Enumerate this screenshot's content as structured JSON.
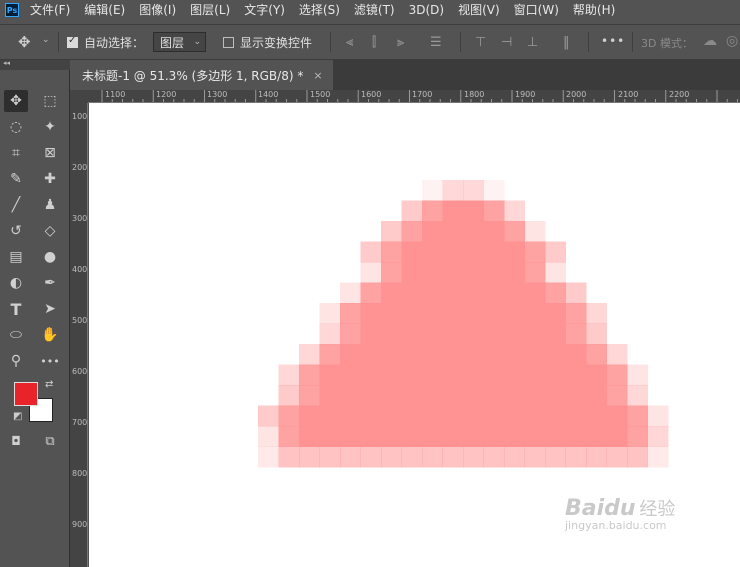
{
  "app": {
    "logo": "Ps"
  },
  "menu": [
    "文件(F)",
    "编辑(E)",
    "图像(I)",
    "图层(L)",
    "文字(Y)",
    "选择(S)",
    "滤镜(T)",
    "3D(D)",
    "视图(V)",
    "窗口(W)",
    "帮助(H)"
  ],
  "options": {
    "auto_select_label": "自动选择：",
    "auto_select_checked": true,
    "layer_dropdown": "图层",
    "show_transform_label": "显示变换控件",
    "show_transform_checked": false,
    "more": "•••",
    "mode_3d": "3D 模式："
  },
  "panel_collapse": "◂◂",
  "document_tab": {
    "title": "未标题-1 @ 51.3% (多边形 1, RGB/8) *",
    "close": "×"
  },
  "ruler_top": [
    "1100",
    "1200",
    "1300",
    "1400",
    "1500",
    "1600",
    "1700",
    "1800",
    "1900",
    "2000",
    "2100",
    "2200"
  ],
  "ruler_left": [
    "100",
    "200",
    "300",
    "400",
    "500",
    "600",
    "700",
    "800",
    "900"
  ],
  "tools": {
    "move": "✥",
    "marquee": "⬚",
    "lasso": "◌",
    "magic_wand": "✦",
    "crop": "⌗",
    "frame": "⊠",
    "eyedropper": "✎",
    "healing": "✚",
    "brush": "╱",
    "stamp": "♟",
    "history_brush": "↺",
    "eraser": "◇",
    "gradient": "▤",
    "blur": "●",
    "dodge": "◐",
    "pen": "✒",
    "type": "T",
    "path_select": "➤",
    "ellipse": "⬭",
    "hand": "✋",
    "zoom": "⚲",
    "more": "•••",
    "swap": "⇄",
    "default": "◩",
    "quick_mask": "◘",
    "screen_mode": "⧉"
  },
  "colors": {
    "foreground": "#e8232a",
    "background": "#ffffff",
    "shape_fill": "#ff9292"
  },
  "watermark": {
    "brand": "Baidu",
    "brand_cn": "经验",
    "url": "jingyan.baidu.com"
  }
}
